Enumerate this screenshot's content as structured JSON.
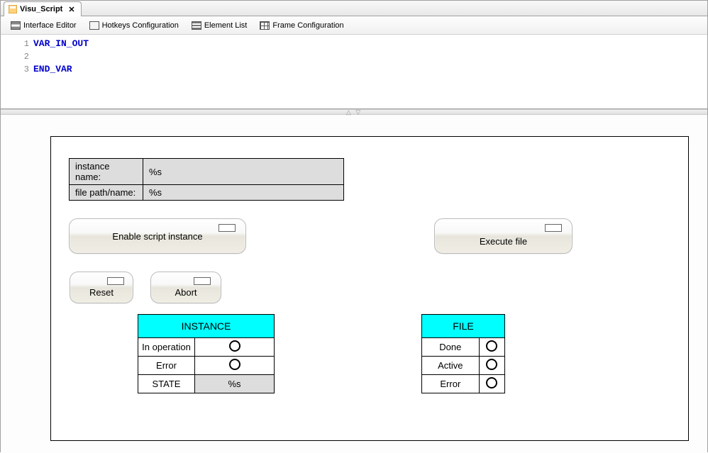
{
  "tab": {
    "title": "Visu_Script"
  },
  "toolbar": {
    "interface_editor": "Interface Editor",
    "hotkeys": "Hotkeys Configuration",
    "element_list": "Element List",
    "frame_config": "Frame Configuration"
  },
  "code": {
    "lines": [
      "VAR_IN_OUT",
      "",
      "END_VAR"
    ],
    "line_numbers": [
      "1",
      "2",
      "3"
    ]
  },
  "info": {
    "instance_label": "instance name:",
    "instance_value": "%s",
    "filepath_label": "file path/name:",
    "filepath_value": "%s"
  },
  "buttons": {
    "enable": "Enable script instance",
    "execute": "Execute file",
    "reset": "Reset",
    "abort": "Abort"
  },
  "instance_status": {
    "header": "INSTANCE",
    "in_operation": "In operation",
    "error": "Error",
    "state_label": "STATE",
    "state_value": "%s"
  },
  "file_status": {
    "header": "FILE",
    "done": "Done",
    "active": "Active",
    "error": "Error"
  }
}
